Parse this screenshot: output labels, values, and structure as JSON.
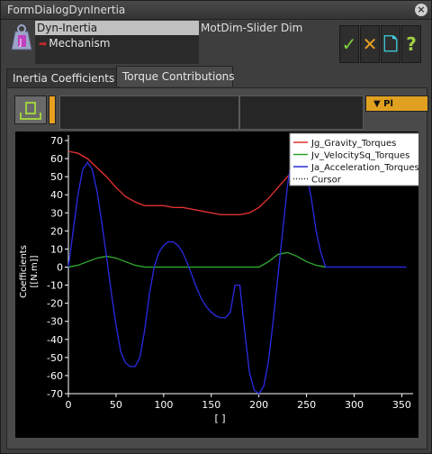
{
  "window": {
    "title": "FormDialogDynInertia",
    "close_glyph": "×"
  },
  "tree": {
    "selected": "Dyn-Inertia",
    "child": "Mechanism"
  },
  "subtitle": "MotDim-Slider Dim",
  "buttons": {
    "ok": {
      "glyph": "✓",
      "color": "#7fd23c"
    },
    "cancel": {
      "glyph": "✕",
      "color": "#e8a020"
    },
    "new": {
      "glyph": "🗋",
      "color": "#40d0e0"
    },
    "help": {
      "glyph": "?",
      "color": "#a0d040"
    }
  },
  "tabs": [
    {
      "label": "Inertia Coefficients",
      "active": false
    },
    {
      "label": "Torque Contributions",
      "active": true
    }
  ],
  "toolbar": {
    "dropdown_label": "▼   Pl"
  },
  "chart_data": {
    "type": "line",
    "xlim": [
      0,
      360
    ],
    "ylim": [
      -70,
      70
    ],
    "xticks": [
      0,
      50,
      100,
      150,
      200,
      250,
      300,
      350
    ],
    "yticks": [
      70,
      60,
      50,
      40,
      30,
      20,
      10,
      0,
      -10,
      -20,
      -30,
      -40,
      -50,
      -60,
      -70
    ],
    "xlabel": "[ ]",
    "ylabel": "Coefficients [[N.m]]",
    "legend": [
      "Jg_Gravity_Torques",
      "Jv_VelocitySq_Torques",
      "Ja_Acceleration_Torques",
      "Cursor"
    ],
    "series": [
      {
        "name": "Jg_Gravity_Torques",
        "color": "#e03030",
        "x": [
          0,
          10,
          20,
          30,
          40,
          50,
          60,
          70,
          80,
          90,
          100,
          110,
          120,
          130,
          140,
          150,
          160,
          170,
          180,
          190,
          200,
          210,
          220,
          230,
          240,
          250,
          260,
          270
        ],
        "y": [
          64,
          63,
          60,
          55,
          50,
          44,
          39,
          36,
          34,
          34,
          34,
          33,
          33,
          32,
          31,
          30,
          29,
          29,
          29,
          30,
          33,
          38,
          44,
          50,
          55,
          60,
          63,
          64
        ]
      },
      {
        "name": "Jv_VelocitySq_Torques",
        "color": "#2ea02e",
        "x": [
          0,
          10,
          20,
          30,
          40,
          50,
          60,
          70,
          80,
          90,
          100,
          200,
          210,
          220,
          230,
          240,
          250,
          260,
          270
        ],
        "y": [
          0,
          1,
          3,
          5,
          6,
          5,
          3,
          1,
          0,
          0,
          0,
          0,
          3,
          7,
          8,
          6,
          3,
          1,
          0
        ]
      },
      {
        "name": "Ja_Acceleration_Torques",
        "color": "#2828d8",
        "x": [
          0,
          5,
          10,
          15,
          20,
          25,
          30,
          35,
          40,
          45,
          50,
          55,
          60,
          65,
          70,
          75,
          80,
          85,
          90,
          95,
          100,
          105,
          110,
          115,
          120,
          125,
          130,
          135,
          140,
          145,
          150,
          155,
          160,
          165,
          170,
          175,
          180,
          185,
          190,
          195,
          200,
          205,
          210,
          215,
          220,
          225,
          230,
          235,
          240,
          245,
          250,
          255,
          260,
          265,
          270,
          280,
          300,
          320,
          340,
          355
        ],
        "y": [
          0,
          20,
          40,
          54,
          58,
          54,
          42,
          25,
          6,
          -14,
          -32,
          -47,
          -53,
          -55,
          -55,
          -50,
          -35,
          -15,
          0,
          8,
          12,
          14,
          14,
          12,
          8,
          2,
          -5,
          -12,
          -18,
          -22,
          -25,
          -27,
          -28,
          -28,
          -25,
          -10,
          -10,
          -35,
          -58,
          -68,
          -70,
          -66,
          -52,
          -30,
          -5,
          20,
          45,
          62,
          67,
          63,
          52,
          38,
          20,
          8,
          0,
          0,
          0,
          0,
          0,
          0
        ]
      },
      {
        "name": "Cursor",
        "color": "#ffffff",
        "x": [],
        "y": []
      }
    ]
  }
}
